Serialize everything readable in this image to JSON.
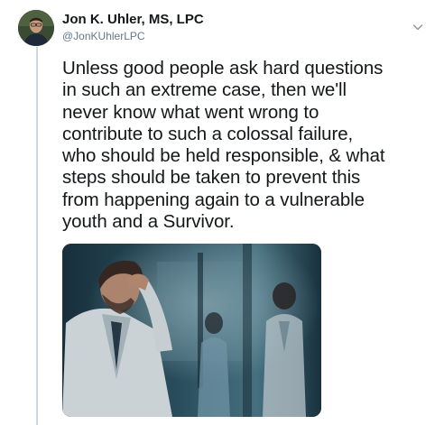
{
  "tweet": {
    "author_name": "Jon K. Uhler, MS, LPC",
    "author_handle": "@JonKUhlerLPC",
    "text_lines": [
      "Unless good people ask hard questions",
      "in such an extreme case, then we'll",
      "never know what went wrong to",
      "contribute to such a colossal failure,",
      "who should be held responsible, & what",
      "steps should be taken to prevent this",
      "from happening again to a vulnerable",
      "youth and a Survivor."
    ],
    "avatar_icon": "profile-photo",
    "menu_icon": "chevron-down-icon",
    "media_description_icon": "photo-doctor-head-in-hand"
  },
  "colors": {
    "name": "#14171a",
    "handle": "#657786",
    "thread_line": "#cfd9de"
  }
}
